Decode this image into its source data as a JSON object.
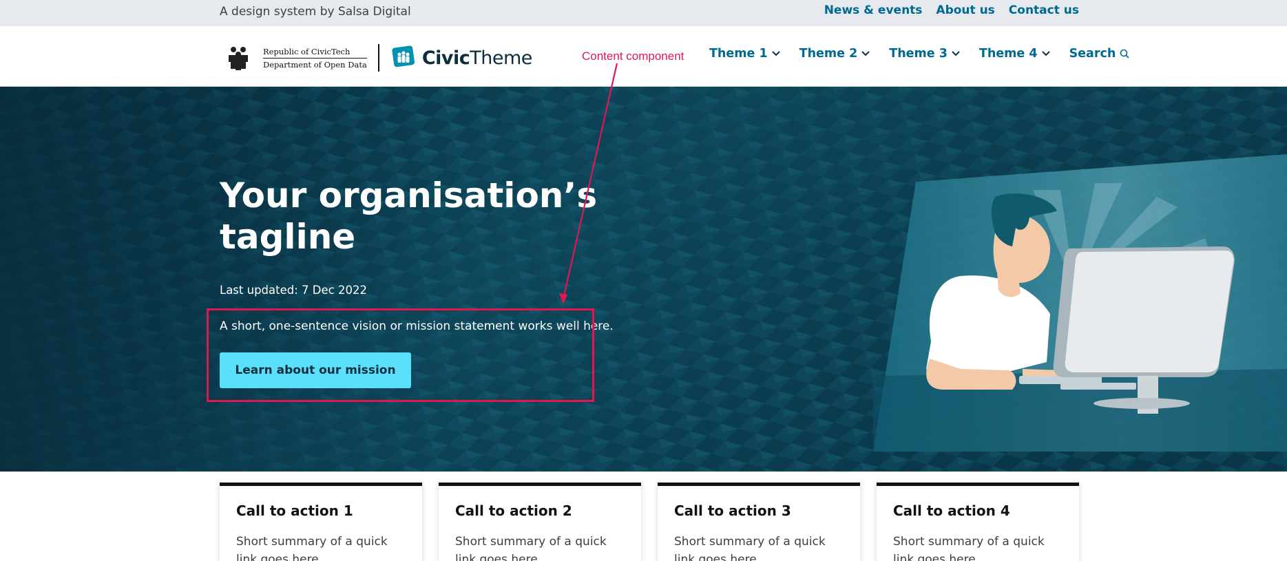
{
  "topbar": {
    "tagline": "A design system by Salsa Digital",
    "links": [
      "News & events",
      "About us",
      "Contact us"
    ]
  },
  "header": {
    "gov_line1": "Republic of CivicTech",
    "gov_line2": "Department of Open Data",
    "brand_bold": "Civic",
    "brand_light": "Theme",
    "nav": [
      "Theme 1",
      "Theme 2",
      "Theme 3",
      "Theme 4"
    ],
    "search_label": "Search"
  },
  "annotation": {
    "label": "Content component",
    "color": "#e3174f"
  },
  "hero": {
    "title": "Your organisation’s tagline",
    "updated": "Last updated: 7 Dec 2022",
    "statement": "A short, one-sentence vision or mission statement works well here.",
    "button_label": "Learn about our mission"
  },
  "cards": [
    {
      "title": "Call to action 1",
      "summary": "Short summary of a quick link goes here"
    },
    {
      "title": "Call to action 2",
      "summary": "Short summary of a quick link goes here"
    },
    {
      "title": "Call to action 3",
      "summary": "Short summary of a quick link goes here"
    },
    {
      "title": "Call to action 4",
      "summary": "Short summary of a quick link goes here"
    }
  ],
  "colors": {
    "brand_link": "#00698f",
    "hero_bg": "#0b3a4d",
    "button": "#5ae0fa",
    "annotation": "#e3174f"
  }
}
